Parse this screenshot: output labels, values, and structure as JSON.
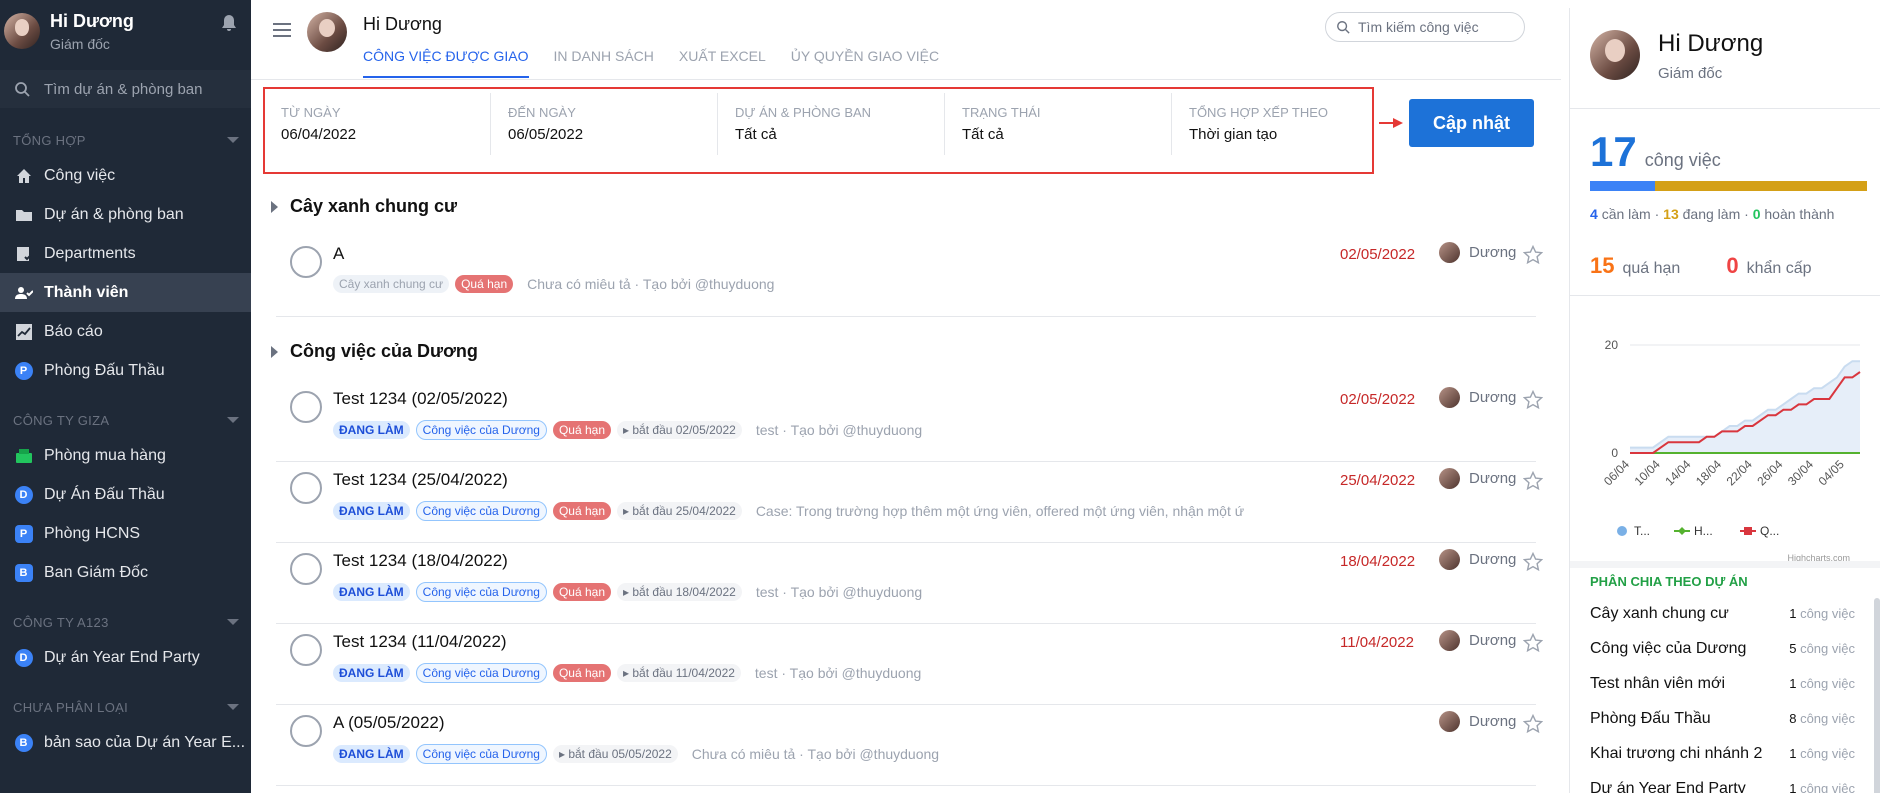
{
  "sidebar": {
    "user": {
      "name": "Hi Dương",
      "role": "Giám đốc"
    },
    "search_placeholder": "Tìm dự án & phòng ban",
    "sections": [
      {
        "title": "Tổng hợp"
      },
      {
        "title": "Công ty GIZA"
      },
      {
        "title": "Công ty A123"
      },
      {
        "title": "Chưa phân loại"
      }
    ],
    "items": {
      "tasks": "Công việc",
      "projects": "Dự án & phòng ban",
      "departments": "Departments",
      "members": "Thành viên",
      "reports": "Báo cáo",
      "bidding": "Phòng Đấu Thầu",
      "purchasing": "Phòng mua hàng",
      "bid_project": "Dự Án Đấu Thầu",
      "hcns": "Phòng HCNS",
      "board": "Ban Giám Đốc",
      "yearend": "Dự án Year End Party",
      "copy_yearend": "bản sao của Dự án Year E..."
    },
    "badges": {
      "bidding": "P",
      "bid_project": "D",
      "hcns": "P",
      "board": "B",
      "yearend": "D",
      "copy_yearend": "B"
    }
  },
  "header": {
    "title": "Hi Dương",
    "tabs": [
      "Công việc được giao",
      "In danh sách",
      "Xuất Excel",
      "Ủy quyền giao việc"
    ],
    "search_placeholder": "Tìm kiếm công việc"
  },
  "filters": {
    "from": {
      "label": "Từ ngày",
      "value": "06/04/2022"
    },
    "to": {
      "label": "Đến ngày",
      "value": "06/05/2022"
    },
    "project": {
      "label": "Dự án & phòng ban",
      "value": "Tất cả"
    },
    "status": {
      "label": "Trạng thái",
      "value": "Tất cả"
    },
    "sort": {
      "label": "Tổng hợp xếp theo",
      "value": "Thời gian tạo"
    },
    "update_button": "Cập nhật"
  },
  "groups": [
    {
      "title": "Cây xanh chung cư",
      "tasks": [
        {
          "title": "A",
          "project": "Cây xanh chung cư",
          "overdue": "Quá hạn",
          "desc": "Chưa có miêu tả · Tạo bởi @thuyduong",
          "due": "02/05/2022",
          "assignee": "Dương"
        }
      ]
    },
    {
      "title": "Công việc của Dương",
      "tasks": [
        {
          "title": "Test 1234 (02/05/2022)",
          "status": "Đang làm",
          "project": "Công việc của Dương",
          "overdue": "Quá hạn",
          "start": "bắt đầu 02/05/2022",
          "desc": "test · Tạo bởi @thuyduong",
          "due": "02/05/2022",
          "assignee": "Dương"
        },
        {
          "title": "Test 1234 (25/04/2022)",
          "status": "Đang làm",
          "project": "Công việc của Dương",
          "overdue": "Quá hạn",
          "start": "bắt đầu 25/04/2022",
          "desc": "Case:  Trong trường hợp thêm một ứng viên, offered một ứng viên, nhận một ứ",
          "due": "25/04/2022",
          "assignee": "Dương"
        },
        {
          "title": "Test 1234 (18/04/2022)",
          "status": "Đang làm",
          "project": "Công việc của Dương",
          "overdue": "Quá hạn",
          "start": "bắt đầu 18/04/2022",
          "desc": "test · Tạo bởi @thuyduong",
          "due": "18/04/2022",
          "assignee": "Dương"
        },
        {
          "title": "Test 1234 (11/04/2022)",
          "status": "Đang làm",
          "project": "Công việc của Dương",
          "overdue": "Quá hạn",
          "start": "bắt đầu 11/04/2022",
          "desc": "test · Tạo bởi @thuyduong",
          "due": "11/04/2022",
          "assignee": "Dương"
        },
        {
          "title": "A (05/05/2022)",
          "status": "Đang làm",
          "project": "Công việc của Dương",
          "start": "bắt đầu 05/05/2022",
          "desc": "Chưa có miêu tả · Tạo bởi @thuyduong",
          "due": "",
          "assignee": "Dương"
        }
      ]
    }
  ],
  "right_panel": {
    "name": "Hi Dương",
    "role": "Giám đốc",
    "total": "17",
    "total_label": "công việc",
    "todo": "4",
    "todo_label": "cần làm",
    "doing": "13",
    "doing_label": "đang làm",
    "done": "0",
    "done_label": "hoàn thành",
    "overdue": "15",
    "overdue_label": "quá hạn",
    "urgent": "0",
    "urgent_label": "khẩn cấp",
    "section_title": "Phân chia theo dự án",
    "projects": [
      {
        "name": "Cây xanh chung cư",
        "count": "1",
        "unit": "công việc"
      },
      {
        "name": "Công việc của Dương",
        "count": "5",
        "unit": "công việc"
      },
      {
        "name": "Test nhân viên mới",
        "count": "1",
        "unit": "công việc"
      },
      {
        "name": "Phòng Đấu Thầu",
        "count": "8",
        "unit": "công việc"
      },
      {
        "name": "Khai trương chi nhánh 2",
        "count": "1",
        "unit": "công việc"
      },
      {
        "name": "Dự án Year End Party",
        "count": "1",
        "unit": "công việc"
      }
    ],
    "chart": {
      "y_ticks": [
        "0",
        "20"
      ],
      "x_ticks": [
        "06/04",
        "10/04",
        "14/04",
        "18/04",
        "22/04",
        "26/04",
        "30/04",
        "04/05"
      ],
      "legend": [
        "T...",
        "H...",
        "Q..."
      ],
      "credit": "Highcharts.com"
    }
  },
  "chart_data": {
    "type": "line",
    "x": [
      "06/04",
      "07/04",
      "08/04",
      "09/04",
      "10/04",
      "11/04",
      "12/04",
      "13/04",
      "14/04",
      "15/04",
      "16/04",
      "17/04",
      "18/04",
      "19/04",
      "20/04",
      "21/04",
      "22/04",
      "23/04",
      "24/04",
      "25/04",
      "26/04",
      "27/04",
      "28/04",
      "29/04",
      "30/04",
      "01/05",
      "02/05",
      "03/05",
      "04/05",
      "05/05",
      "06/05"
    ],
    "series": [
      {
        "name": "T...",
        "type": "area",
        "values": [
          1,
          1,
          1,
          1,
          2,
          3,
          3,
          3,
          3,
          3,
          3,
          3,
          4,
          5,
          5,
          6,
          6,
          7,
          8,
          8,
          9,
          10,
          11,
          11,
          12,
          12,
          13,
          14,
          16,
          17,
          17
        ]
      },
      {
        "name": "H...",
        "values": [
          0,
          0,
          0,
          0,
          0,
          0,
          0,
          0,
          0,
          0,
          0,
          0,
          0,
          0,
          0,
          0,
          0,
          0,
          0,
          0,
          0,
          0,
          0,
          0,
          0,
          0,
          0,
          0,
          0,
          0,
          0
        ]
      },
      {
        "name": "Q...",
        "values": [
          0,
          0,
          0,
          0,
          1,
          2,
          2,
          2,
          2,
          2,
          3,
          3,
          4,
          4,
          4,
          5,
          5,
          6,
          7,
          7,
          8,
          8,
          9,
          9,
          10,
          10,
          10,
          12,
          14,
          14,
          15
        ]
      }
    ],
    "ylim": [
      0,
      20
    ]
  }
}
